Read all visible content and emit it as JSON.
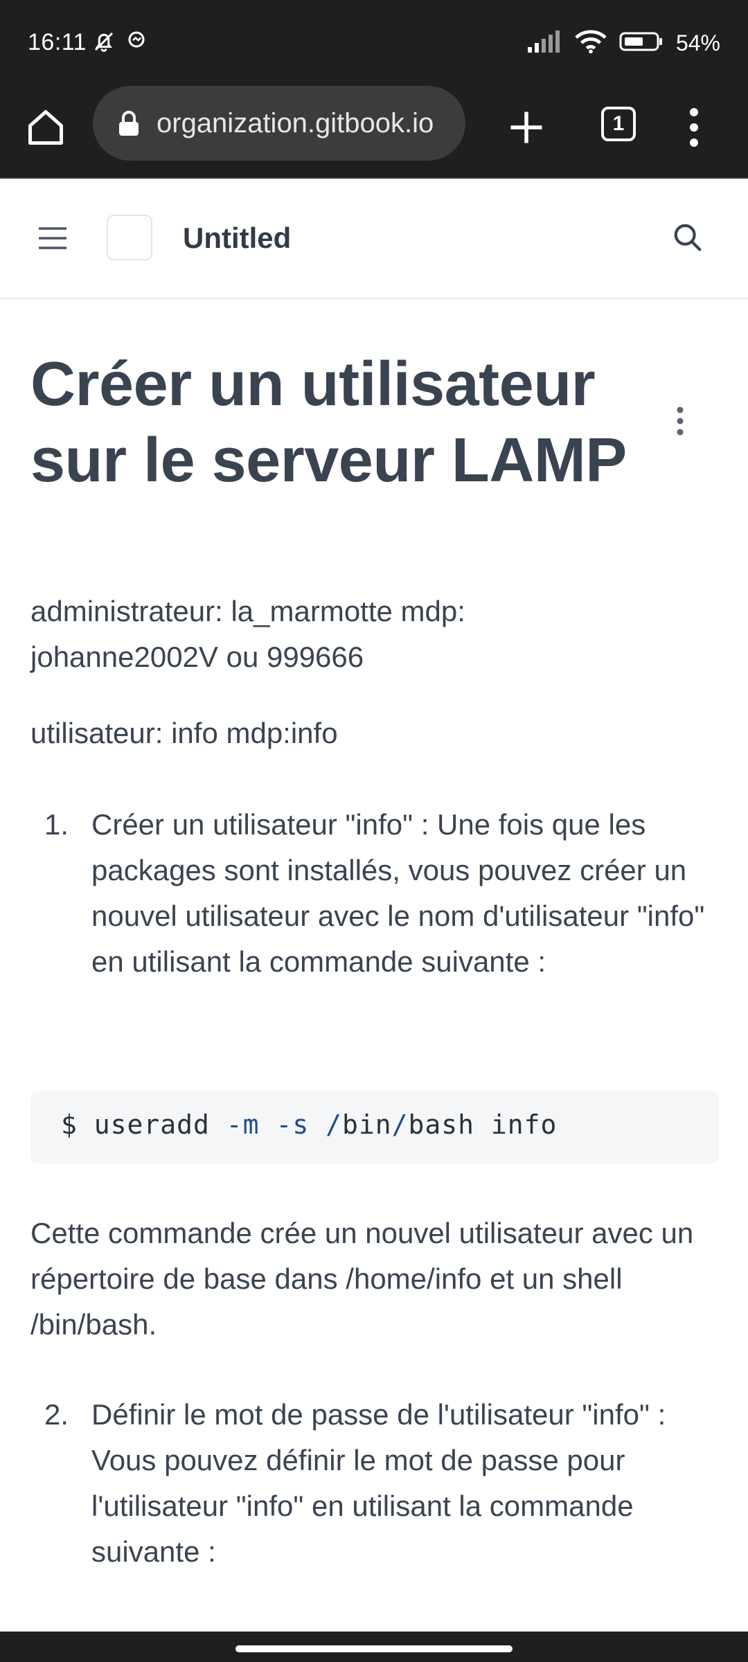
{
  "status_bar": {
    "time": "16:11",
    "battery": "54%"
  },
  "browser": {
    "url": "organization.gitbook.io",
    "tab_count": "1"
  },
  "site": {
    "title": "Untitled"
  },
  "page": {
    "title": "Créer un utilisateur sur le serveur LAMP",
    "admin_line": "administrateur: la_marmotte mdp: johanne2002V ou 999666",
    "user_line": "utilisateur: info mdp:info",
    "steps": [
      {
        "number": "1.",
        "text": "Créer un utilisateur \"info\" : Une fois que les packages sont installés, vous pouvez créer un nouvel utilisateur avec le nom d'utilisateur \"info\" en utilisant la commande suivante :"
      },
      {
        "number": "2.",
        "text": "Définir le mot de passe de l'utilisateur \"info\" : Vous pouvez définir le mot de passe pour l'utilisateur \"info\" en utilisant la commande suivante :"
      }
    ],
    "code": {
      "prompt": "$ useradd ",
      "flag1": "-m",
      "space1": " ",
      "flag2": "-s",
      "space2": " ",
      "slash1": "/",
      "dir": "bin",
      "slash2": "/",
      "rest": "bash info"
    },
    "explanation": "Cette commande crée un nouvel utilisateur avec un répertoire de base dans /home/info et un shell /bin/bash."
  }
}
